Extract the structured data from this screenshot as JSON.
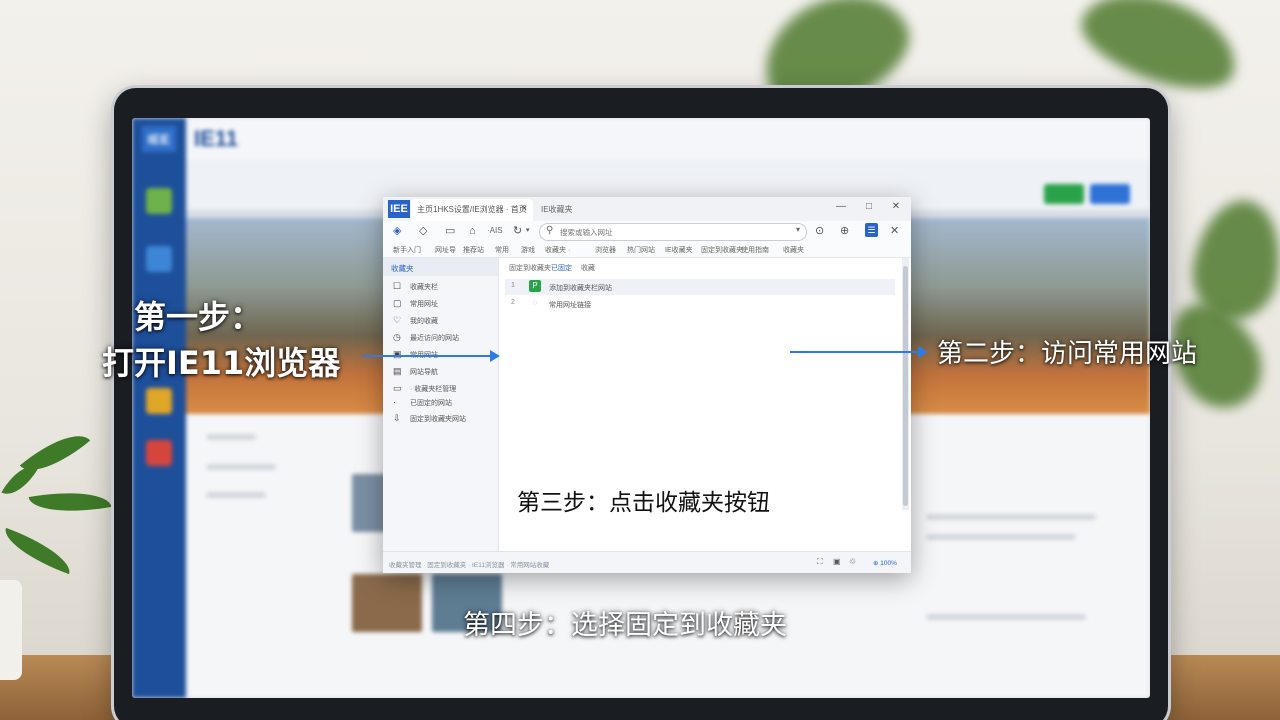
{
  "background": {
    "app_logo": "IEE",
    "app_title": "IE11"
  },
  "ie_window": {
    "badge": "IEE",
    "tab_title": "主页1HKS设置/IE浏览器 · 首页",
    "tab_close": "×",
    "tab2_title": "IE收藏夹",
    "window_buttons": [
      "—",
      "□",
      "✕"
    ],
    "toolbar_icons": [
      "back-icon",
      "home-icon",
      "page-icon",
      "favorites-star-icon",
      "refresh-icon",
      "dropdown-icon"
    ],
    "toolbar_text": "·AIS",
    "address_placeholder": "搜索或输入网址",
    "address_caret": "▾",
    "right_icons": [
      "settings-icon",
      "download-icon",
      "favorites-button-icon",
      "close-sidebar-icon"
    ],
    "link_bar": [
      "新手入门",
      "网址导",
      "推荐站",
      "常用",
      "游戏",
      "收藏夹 ·",
      "浏览器",
      "热门网站",
      "IE收藏夹",
      "固定到收藏夹",
      "使用指南",
      "收藏夹"
    ],
    "sidebar": {
      "header": "收藏夹",
      "items": [
        {
          "label": "收藏夹栏",
          "icon": "☐"
        },
        {
          "label": "常用网址",
          "icon": "▢"
        },
        {
          "label": "我的收藏",
          "icon": "♡"
        },
        {
          "label": "最近访问的网站",
          "icon": "◷"
        },
        {
          "label": "常用网站",
          "icon": "▣"
        },
        {
          "label": "网站导航",
          "icon": "▤"
        },
        {
          "label": "· 收藏夹栏管理",
          "icon": "▭"
        },
        {
          "label": "已固定的网站",
          "icon": "·"
        },
        {
          "label": "固定到收藏夹网站",
          "icon": "⇩"
        }
      ]
    },
    "main_tabs": [
      "固定到收藏夹",
      "已固定",
      "收藏"
    ],
    "favorites": [
      {
        "num": "1",
        "label": "添加到收藏夹栏网站",
        "icon": "P"
      },
      {
        "num": "2",
        "label": "常用网址链接",
        "icon": "◌"
      }
    ],
    "status_text": "收藏夹管理 · 固定到收藏夹 · IE11浏览器 · 常用网站收藏",
    "status_icons": [
      "⛶",
      "▣",
      "♲"
    ],
    "zoom": "⊕ 100%"
  },
  "captions": {
    "step1_line1": "第一步：",
    "step1_line2": "打开IE11浏览器",
    "step2": "第二步：访问常用网站",
    "step3": "第三步：点击收藏夹按钮",
    "step4": "第四步：选择固定到收藏夹"
  },
  "colors": {
    "accent": "#2a62c6",
    "arrow": "#2f7be6",
    "caption_text": "#ffffff"
  }
}
